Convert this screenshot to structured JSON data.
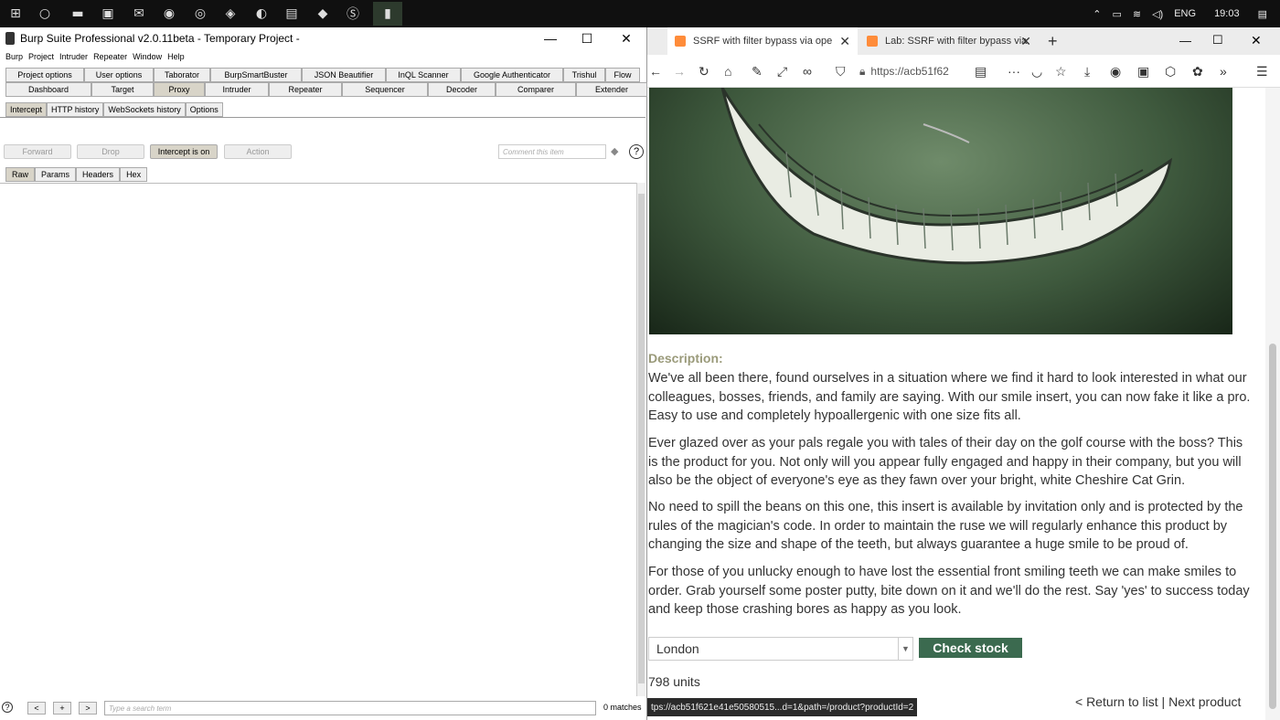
{
  "taskbar": {
    "language": "ENG",
    "time": "19:03"
  },
  "burp": {
    "title": "Burp Suite Professional v2.0.11beta - Temporary Project -",
    "menu": [
      "Burp",
      "Project",
      "Intruder",
      "Repeater",
      "Window",
      "Help"
    ],
    "tabs_row1": [
      "Project options",
      "User options",
      "Taborator",
      "BurpSmartBuster",
      "JSON Beautifier",
      "InQL Scanner",
      "Google Authenticator",
      "Trishul",
      "Flow"
    ],
    "tabs_row2": [
      "Dashboard",
      "Target",
      "Proxy",
      "Intruder",
      "Repeater",
      "Sequencer",
      "Decoder",
      "Comparer",
      "Extender"
    ],
    "subtabs": [
      "Intercept",
      "HTTP history",
      "WebSockets history",
      "Options"
    ],
    "buttons": {
      "forward": "Forward",
      "drop": "Drop",
      "intercept": "Intercept is on",
      "action": "Action"
    },
    "comment_placeholder": "Comment this item",
    "help": "?",
    "message_tabs": [
      "Raw",
      "Params",
      "Headers",
      "Hex"
    ],
    "bottom": {
      "help": "?",
      "prev": "<",
      "add": "+",
      "next": ">",
      "search_placeholder": "Type a search term",
      "matches": "0 matches"
    }
  },
  "firefox": {
    "tabs": [
      {
        "title": "SSRF with filter bypass via ope"
      },
      {
        "title": "Lab: SSRF with filter bypass via"
      }
    ],
    "new_tab": "+",
    "url": "https://acb51f62",
    "description_label": "Description:",
    "paragraphs": [
      "We've all been there, found ourselves in a situation where we find it hard to look interested in what our colleagues, bosses, friends, and family are saying. With our smile insert, you can now fake it like a pro. Easy to use and completely hypoallergenic with one size fits all.",
      "Ever glazed over as your pals regale you with tales of their day on the golf course with the boss? This is the product for you. Not only will you appear fully engaged and happy in their company, but you will also be the object of everyone's eye as they fawn over your bright, white Cheshire Cat Grin.",
      "No need to spill the beans on this one, this insert is available by invitation only and is protected by the rules of the magician's code. In order to maintain the ruse we will regularly enhance this product by changing the size and shape of the teeth, but always guarantee a huge smile to be proud of.",
      "For those of you unlucky enough to have lost the essential front smiling teeth we can make smiles to order. Grab yourself some poster putty, bite down on it and we'll do the rest. Say 'yes' to success today and keep those crashing bores as happy as you look."
    ],
    "store_select": "London",
    "check_stock": "Check stock",
    "stock_result": "798 units",
    "status_url": "tps://acb51f621e41e50580515...d=1&path=/product?productId=2",
    "return_link": "< Return to list",
    "separator": "|",
    "next_link": "Next product"
  }
}
